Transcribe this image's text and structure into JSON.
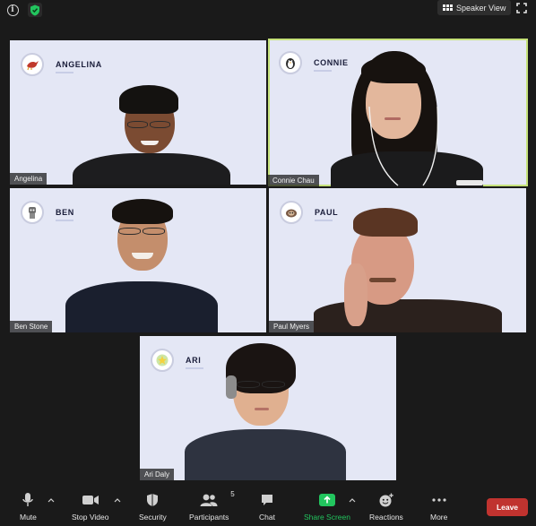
{
  "topbar": {
    "speaker_view_label": "Speaker View",
    "info_icon": "info-icon",
    "shield_icon": "shield-check-icon",
    "fullscreen_icon": "fullscreen-icon",
    "shield_color": "#22c55e"
  },
  "participants": [
    {
      "card_name": "ANGELINA",
      "label": "Angelina",
      "avatar_icon": "bird-icon",
      "active": false
    },
    {
      "card_name": "CONNIE",
      "label": "Connie Chau",
      "avatar_icon": "penguin-icon",
      "active": true
    },
    {
      "card_name": "BEN",
      "label": "Ben Stone",
      "avatar_icon": "robot-icon",
      "active": false
    },
    {
      "card_name": "PAUL",
      "label": "Paul Myers",
      "avatar_icon": "sloth-icon",
      "active": false
    },
    {
      "card_name": "ARI",
      "label": "Ari Daly",
      "avatar_icon": "star-icon",
      "active": false
    }
  ],
  "colors": {
    "tile_bg": "#e4e7f5",
    "active_border": "#c6e27a",
    "leave_bg": "#c0332f",
    "share_green": "#22c55e"
  },
  "toolbar": {
    "mute_label": "Mute",
    "stop_video_label": "Stop Video",
    "security_label": "Security",
    "participants_label": "Participants",
    "participants_count": "5",
    "chat_label": "Chat",
    "share_screen_label": "Share Screen",
    "reactions_label": "Reactions",
    "more_label": "More",
    "leave_label": "Leave"
  }
}
